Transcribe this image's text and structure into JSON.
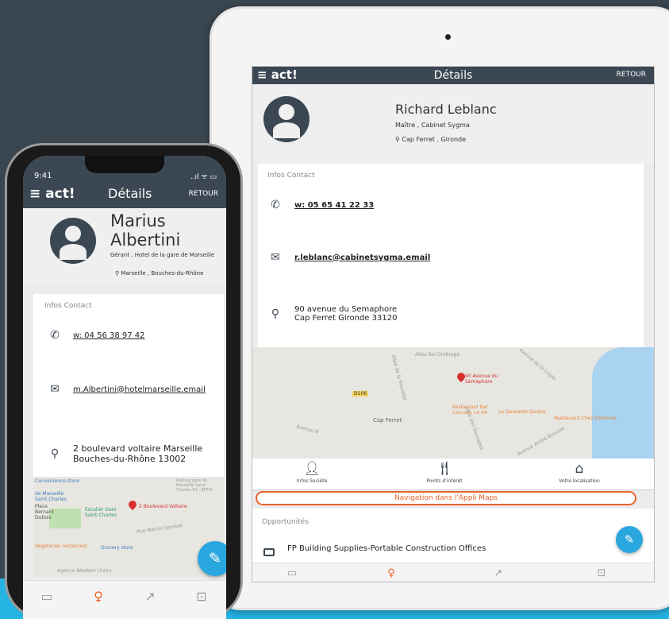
{
  "tablet": {
    "app_logo": "≡ act!",
    "title": "Détails",
    "back_label": "RETOUR",
    "contact_name": "Richard Leblanc",
    "role": "Maître , Cabinet Sygma",
    "location": "Cap Ferret , Gironde",
    "infos_title": "Infos Contact",
    "phone": "w: 05 65 41 22 33",
    "email": "r.leblanc@cabinetsygma.email",
    "address_line1": "90 avenue du Semaphore",
    "address_line2": "Cap Ferret Gironde 33120",
    "map": {
      "labels": [
        "Allée Bel Ombrage",
        "Allée de la Fauvette",
        "Avenue de la Lugas",
        "Cap Ferret",
        "Avenue N",
        "Allée des Sauvages",
        "Avenue André Brousse",
        "D106"
      ],
      "pin_label": "90 Avenue du Sémaphore",
      "pois": [
        "Restaurant Bar Concert, Le 44",
        "Le Quarante Quatre",
        "Restaurant Chez Hortense"
      ]
    },
    "nav": [
      {
        "icon": "person-icon",
        "label": "Infos Société"
      },
      {
        "icon": "cutlery-icon",
        "label": "Points d'intérêt"
      },
      {
        "icon": "home-icon",
        "label": "Votre localisation"
      }
    ],
    "maps_button": "Navigation dans l'Appli Maps",
    "opportunities_title": "Opportunités",
    "opportunity_item": "FP Building Supplies-Portable Construction Offices"
  },
  "phone": {
    "time": "9:41",
    "status_icons": "..ıl ᯤ ▭",
    "app_logo": "≡ act!",
    "title": "Détails",
    "back_label": "RETOUR",
    "contact_name_first": "Marius",
    "contact_name_last": "Albertini",
    "role": "Gérant , Hotel de la gare de Marseille",
    "location": "Marseille , Bouches-du-Rhône",
    "infos_title": "Infos Contact",
    "phone": "w: 04 56 38 97 42",
    "email": "m.Albertini@hotelmarseille.email",
    "address_line1": "2 boulevard voltaire Marseille",
    "address_line2": "Bouches-du-Rhône 13002",
    "map": {
      "labels": [
        "Convenience store",
        "de Marseille Saint Charles",
        "Place Bernard Dubois",
        "Escalier Gare Saint-Charles",
        "Rue Marcel Sembat",
        "Vegetarian restaurant",
        "Grocery store",
        "Agence Western Union",
        "Parking gare de Marseille Saint-Charles P1 - EFFIA"
      ],
      "pin_label": "2 Boulevard Voltaire"
    }
  },
  "colors": {
    "background": "#3a4650",
    "band": "#25b3e3",
    "topbar": "#3b4752",
    "accent": "#e8632a",
    "fab": "#2aa7de"
  }
}
